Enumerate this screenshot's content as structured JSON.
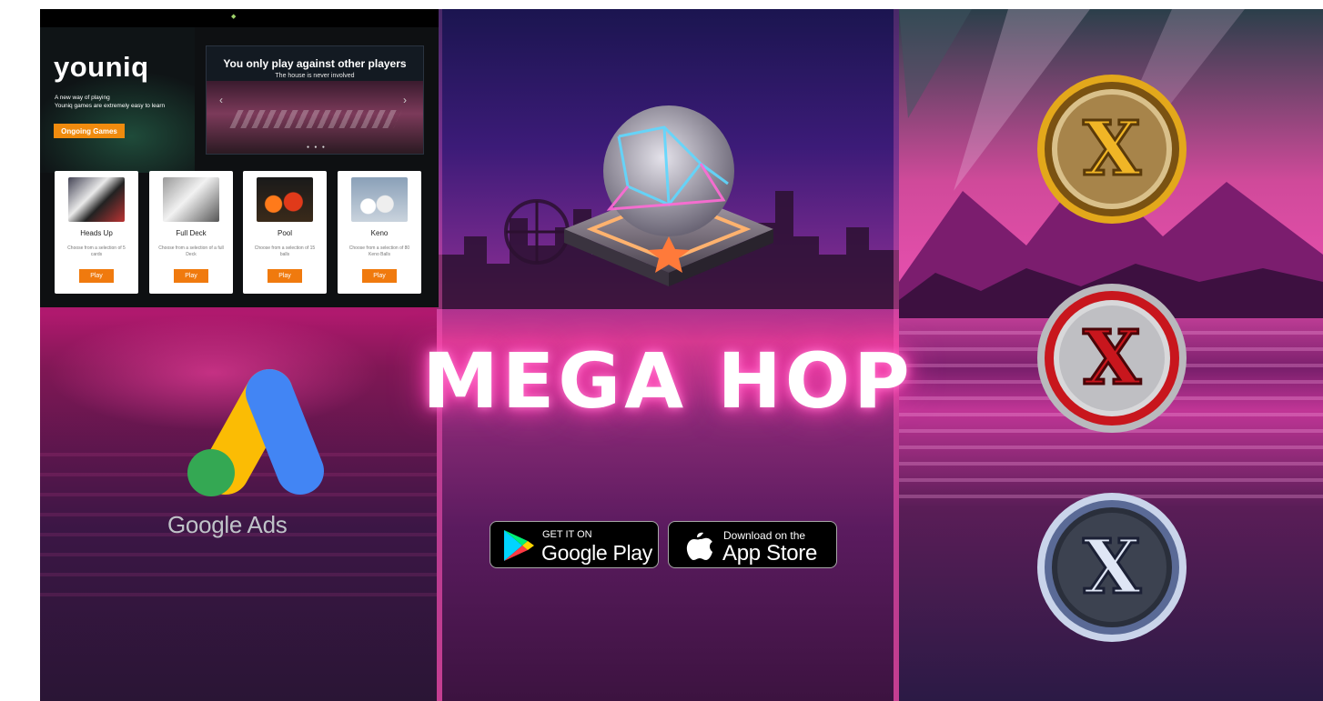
{
  "site": {
    "brand": "youniq",
    "tagline_line1": "A new way of playing",
    "tagline_line2": "Youniq games are extremely easy to learn",
    "ongoing_button": "Ongoing Games",
    "carousel": {
      "headline": "You only play against other players",
      "subline": "The house is never involved",
      "prev_arrow": "‹",
      "next_arrow": "›",
      "dots": "● ● ●"
    },
    "games": [
      {
        "title": "Heads Up",
        "desc": "Choose from a selection of 5 cards",
        "play": "Play"
      },
      {
        "title": "Full Deck",
        "desc": "Choose from a selection of a full Deck",
        "play": "Play"
      },
      {
        "title": "Pool",
        "desc": "Choose from a selection of 15 balls",
        "play": "Play"
      },
      {
        "title": "Keno",
        "desc": "Choose from a selection of 80 Keno Balls",
        "play": "Play"
      }
    ]
  },
  "google_ads": {
    "label": "Google Ads",
    "colors": {
      "blue": "#4285F4",
      "yellow": "#FBBC04",
      "green": "#34A853"
    }
  },
  "hero": {
    "title": "MEGA HOP",
    "glow_color": "#ff3fb0"
  },
  "stores": {
    "google_play": {
      "small": "GET IT ON",
      "big": "Google Play"
    },
    "app_store": {
      "small": "Download on the",
      "big": "App Store"
    }
  },
  "coins": [
    {
      "name": "gold-x-coin",
      "letter": "X",
      "color": "#e3a81b"
    },
    {
      "name": "red-x-coin",
      "letter": "X",
      "color": "#c8161d"
    },
    {
      "name": "silver-x-coin",
      "letter": "X",
      "color": "#c9d4ea"
    }
  ]
}
